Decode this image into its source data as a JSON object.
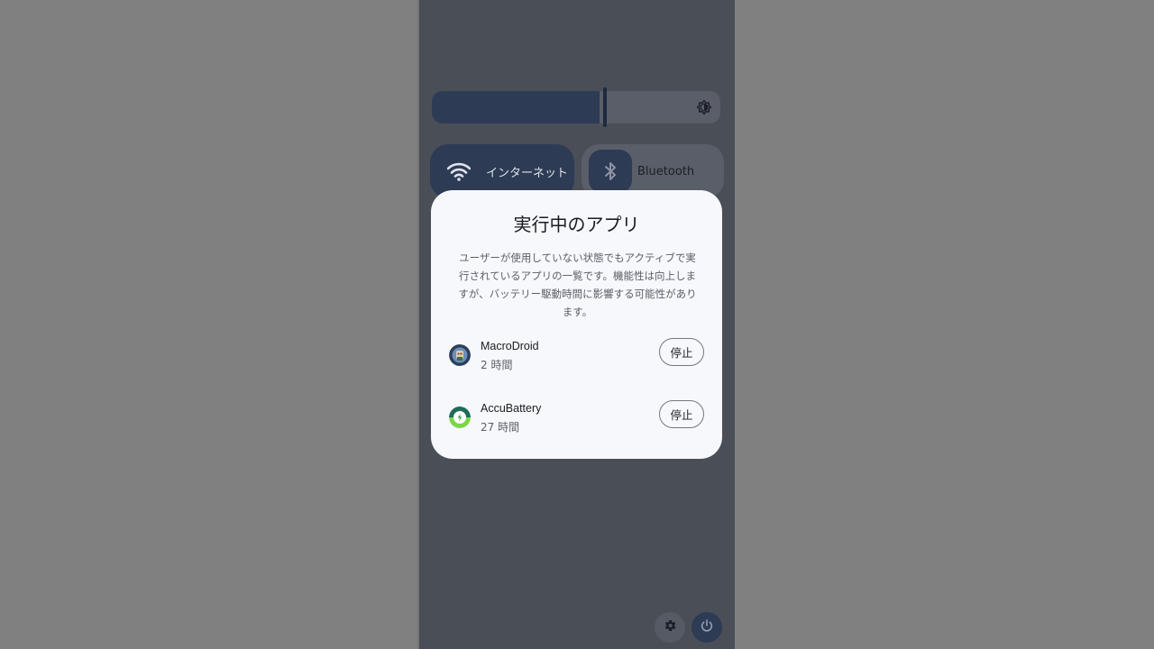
{
  "quick_settings": {
    "brightness": {
      "level": 0.6,
      "icon": "brightness-icon"
    },
    "tiles": [
      {
        "label": "インターネット",
        "icon": "wifi-icon",
        "active": true
      },
      {
        "label": "Bluetooth",
        "icon": "bluetooth-icon",
        "active": false
      }
    ],
    "bottom": {
      "settings_icon": "gear-icon",
      "power_icon": "power-icon"
    }
  },
  "dialog": {
    "title": "実行中のアプリ",
    "description_lines": [
      "ユーザーが使用していない状態でもアクティブで実",
      "行されているアプリの一覧です。機能性は向上しま",
      "すが、バッテリー駆動時間に影響する可能性があり",
      "ます。"
    ],
    "apps": [
      {
        "name": "MacroDroid",
        "time": "2 時間",
        "stop_label": "停止",
        "icon": "macrodroid-icon"
      },
      {
        "name": "AccuBattery",
        "time": "27 時間",
        "stop_label": "停止",
        "icon": "accubattery-icon"
      }
    ]
  },
  "colors": {
    "scrim": "#808080",
    "panel": "#4a4e57",
    "accent": "#2e3b55",
    "dialog_bg": "#f7f8fc"
  }
}
